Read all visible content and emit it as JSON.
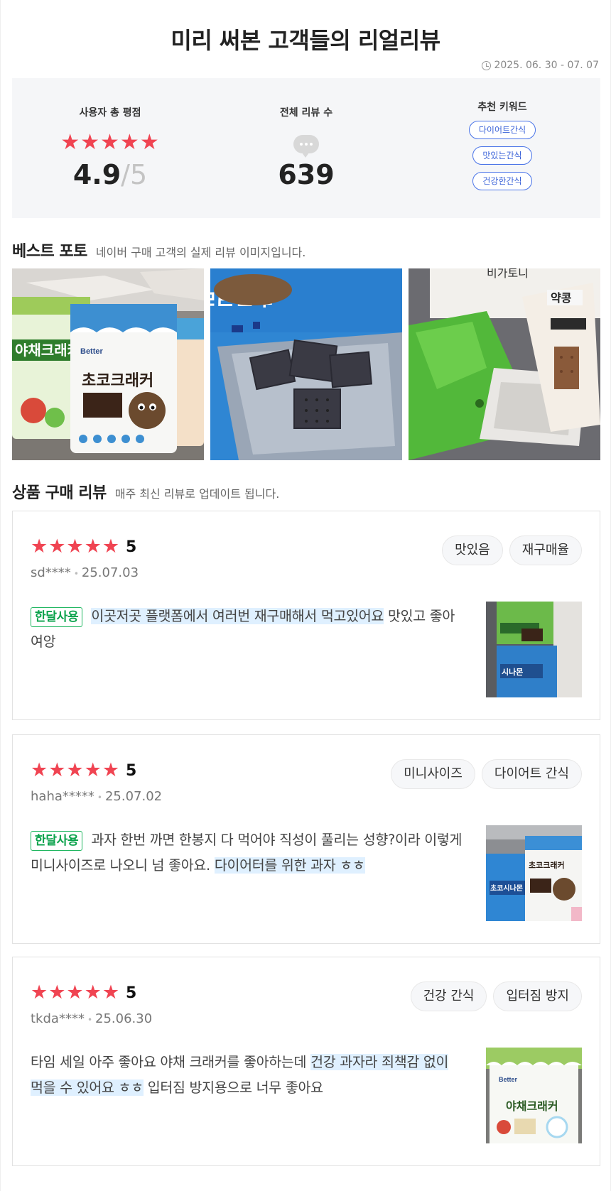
{
  "header": {
    "title": "미리 써본 고객들의 리얼리뷰",
    "period": "2025. 06. 30 - 07. 07"
  },
  "summary": {
    "rating_label": "사용자 총 평점",
    "rating_value": "4.9",
    "rating_max": "5",
    "stars": "★★★★★",
    "count_label": "전체 리뷰 수",
    "count_value": "639",
    "keyword_label": "추천 키워드",
    "keywords": [
      "다이어트간식",
      "맛있는간식",
      "건강한간식"
    ]
  },
  "best_photo": {
    "title": "베스트 포토",
    "subtitle": "네이버 구매 고객의 실제 리뷰 이미지입니다."
  },
  "reviews_section": {
    "title": "상품 구매 리뷰",
    "subtitle": "매주 최신 리뷰로 업데이트 됩니다."
  },
  "reviews": [
    {
      "stars": "★★★★★",
      "score": "5",
      "user": "sd****",
      "date": "25.07.03",
      "tags": [
        "맛있음",
        "재구매율"
      ],
      "badge": "한달사용",
      "text_highlight": "이곳저곳 플랫폼에서 여러번 재구매해서 먹고있어요",
      "text_plain": " 맛있고 좋아여앙"
    },
    {
      "stars": "★★★★★",
      "score": "5",
      "user": "haha*****",
      "date": "25.07.02",
      "tags": [
        "미니사이즈",
        "다이어트 간식"
      ],
      "badge": "한달사용",
      "text_plain": "과자 한번 까면 한봉지 다 먹어야 직성이 풀리는 성향?이라 이렇게 미니사이즈로 나오니 넘 좋아요. ",
      "text_highlight": "다이어터를 위한 과자 ㅎㅎ"
    },
    {
      "stars": "★★★★★",
      "score": "5",
      "user": "tkda****",
      "date": "25.06.30",
      "tags": [
        "건강 간식",
        "입터짐 방지"
      ],
      "text_plain": "타임 세일 아주 좋아요 야채 크래커를 좋아하는데 ",
      "text_highlight": "건강 과자라 죄책감 없이 먹을 수 있어요 ㅎㅎ",
      "text_plain2": " 입터짐 방지용으로 너무 좋아요"
    }
  ],
  "photo_labels": {
    "p1_brand": "Better",
    "p1_product": "초코크래커",
    "p1_side": "야채크래커",
    "p2_product": "초코크래커",
    "t3_product": "야채크래커"
  },
  "colors": {
    "star": "#f04452",
    "keyword_border": "#4a74e8",
    "badge_green": "#0aa24b",
    "highlight": "#dff0ff",
    "summary_bg": "#f5f6f8"
  },
  "icons": {
    "period": "clock-icon",
    "review_count": "speech-bubble-icon",
    "star": "star-icon"
  }
}
